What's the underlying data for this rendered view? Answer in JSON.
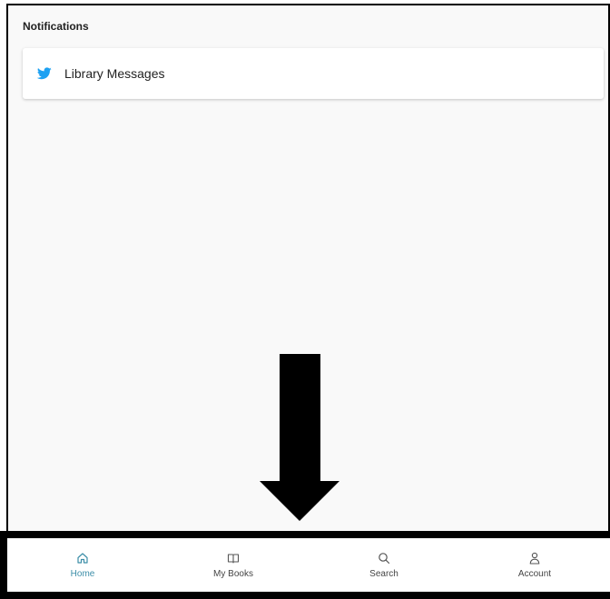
{
  "notifications": {
    "title": "Notifications",
    "items": [
      {
        "label": "Library Messages",
        "icon": "twitter-bird-icon",
        "icon_color": "#1da1f2"
      }
    ]
  },
  "bottom_nav": {
    "active_color": "#3c8ea8",
    "items": [
      {
        "label": "Home",
        "icon": "home-icon",
        "active": true
      },
      {
        "label": "My Books",
        "icon": "book-icon",
        "active": false
      },
      {
        "label": "Search",
        "icon": "search-icon",
        "active": false
      },
      {
        "label": "Account",
        "icon": "person-icon",
        "active": false
      }
    ]
  }
}
